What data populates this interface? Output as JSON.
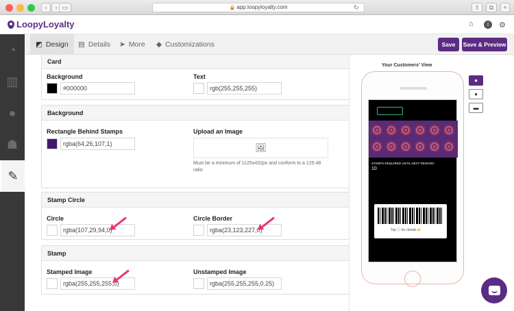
{
  "browser": {
    "url": "app.loopyloyalty.com"
  },
  "app": {
    "logo": "LoopyLoyalty"
  },
  "tabs": [
    {
      "label": "Design"
    },
    {
      "label": "Details"
    },
    {
      "label": "More"
    },
    {
      "label": "Customizations"
    }
  ],
  "actions": {
    "save": "Save",
    "save_preview": "Save & Preview"
  },
  "card": {
    "title": "Card",
    "background_label": "Background",
    "background_value": "#000000",
    "background_color": "#000000",
    "text_label": "Text",
    "text_value": "rgb(255,255,255)",
    "text_color": "#ffffff"
  },
  "background": {
    "title": "Background",
    "rect_label": "Rectangle Behind Stamps",
    "rect_value": "rgba(64,26,107,1)",
    "rect_color": "#401a6b",
    "upload_label": "Upload an Image",
    "upload_hint": "Must be a minimum of 1125x432px and conform to a 125:48 ratio"
  },
  "stamp_circle": {
    "title": "Stamp Circle",
    "circle_label": "Circle",
    "circle_value": "rgba(107,29,94,0)",
    "border_label": "Circle Border",
    "border_value": "rgba(23,123,227,0)"
  },
  "stamp": {
    "title": "Stamp",
    "stamped_label": "Stamped Image",
    "stamped_value": "rgba(255,255,255,0)",
    "unstamped_label": "Unstamped Image",
    "unstamped_value": "rgba(255,255,255,0.25)"
  },
  "preview": {
    "title": "Your Customers' View",
    "stamps_required_label": "STAMPS REQUIRED UNTIL NEXT REWARD",
    "stamps_required_value": "10",
    "tap_hint": "Tap ⓘ for details 👉"
  },
  "colors": {
    "accent": "#5b2c83",
    "arrow": "#e8356e"
  }
}
